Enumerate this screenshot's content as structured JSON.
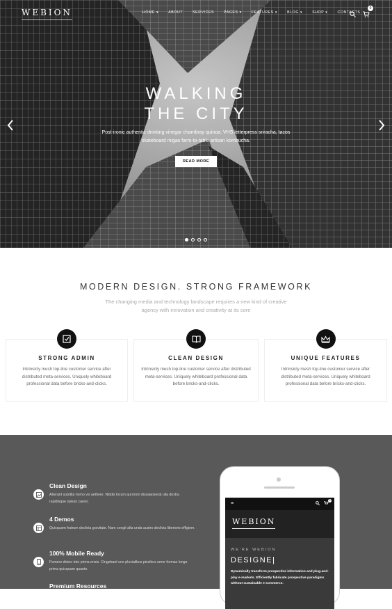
{
  "nav": {
    "logo": "WEBION",
    "menu": [
      "HOME",
      "ABOUT",
      "SERVICES",
      "PAGES",
      "FEATURES",
      "BLOG",
      "SHOP",
      "CONTACTS"
    ],
    "cart_count": "0"
  },
  "hero": {
    "title_line1": "WALKING",
    "title_line2": "THE CITY",
    "subtitle": "Post-ironic authentic drinking vinegar chambray quinoa. VHS letterpress sriracha, tacos skateboard migas farm-to-table artisan kombucha.",
    "button": "READ MORE",
    "slides": 4,
    "active_slide": 1
  },
  "intro": {
    "title": "MODERN DESIGN. STRONG FRAMEWORK",
    "text": "The changing media and technology landscape requires a new kind of creative agency with innovation and creativity at its core"
  },
  "cards": [
    {
      "icon": "checkbox-icon",
      "title": "STRONG ADMIN",
      "text": "Intrinsicly mesh top-line customer service after distributed meta-services. Uniquely whiteboard professional data before bricks-and-clicks."
    },
    {
      "icon": "book-icon",
      "title": "CLEAN DESIGN",
      "text": "Intrinsicly mesh top-line customer service after distributed meta-services. Uniquely whiteboard professional data before bricks-and-clicks."
    },
    {
      "icon": "crown-icon",
      "title": "UNIQUE FEATURES",
      "text": "Intrinsicly mesh top-line customer service after distributed meta-services. Uniquely whiteboard professional data before bricks-and-clicks."
    }
  ],
  "features": [
    {
      "icon": "image-icon",
      "title": "Clean Design",
      "text": "Aberant subdita homo vis aethere. Nitidis locum aurorom dissaepserat ulla dextra rapidisque spisso caeso."
    },
    {
      "icon": "layout-icon",
      "title": "4 Demos",
      "text": "Quicquam fratrum declivia gravitate. Nam coegit alta unda austro declivia liberioris effigiem."
    },
    {
      "icon": "mobile-icon",
      "title": "100% Mobile Ready",
      "text": "Pumero divino toto prima ensis. Cingebant une pluvialibus piscibus umor formas longo prima quicquam quanto."
    },
    {
      "icon": "diamond-icon",
      "title": "Premium Resources",
      "text": ""
    }
  ],
  "phone": {
    "logo": "WEBION",
    "we_are": "WE'RE WEBION",
    "headline": "DESIGNE|",
    "text": "Dynamically transform prospective information and plug-and-play e-markets. Efficiently fabricate prospective paradigms without sustainable e-commerce.",
    "cart_count": "0"
  },
  "colors": {
    "dark_section": "#595959",
    "icon_circle": "#111111",
    "accent_text": "#333333"
  }
}
